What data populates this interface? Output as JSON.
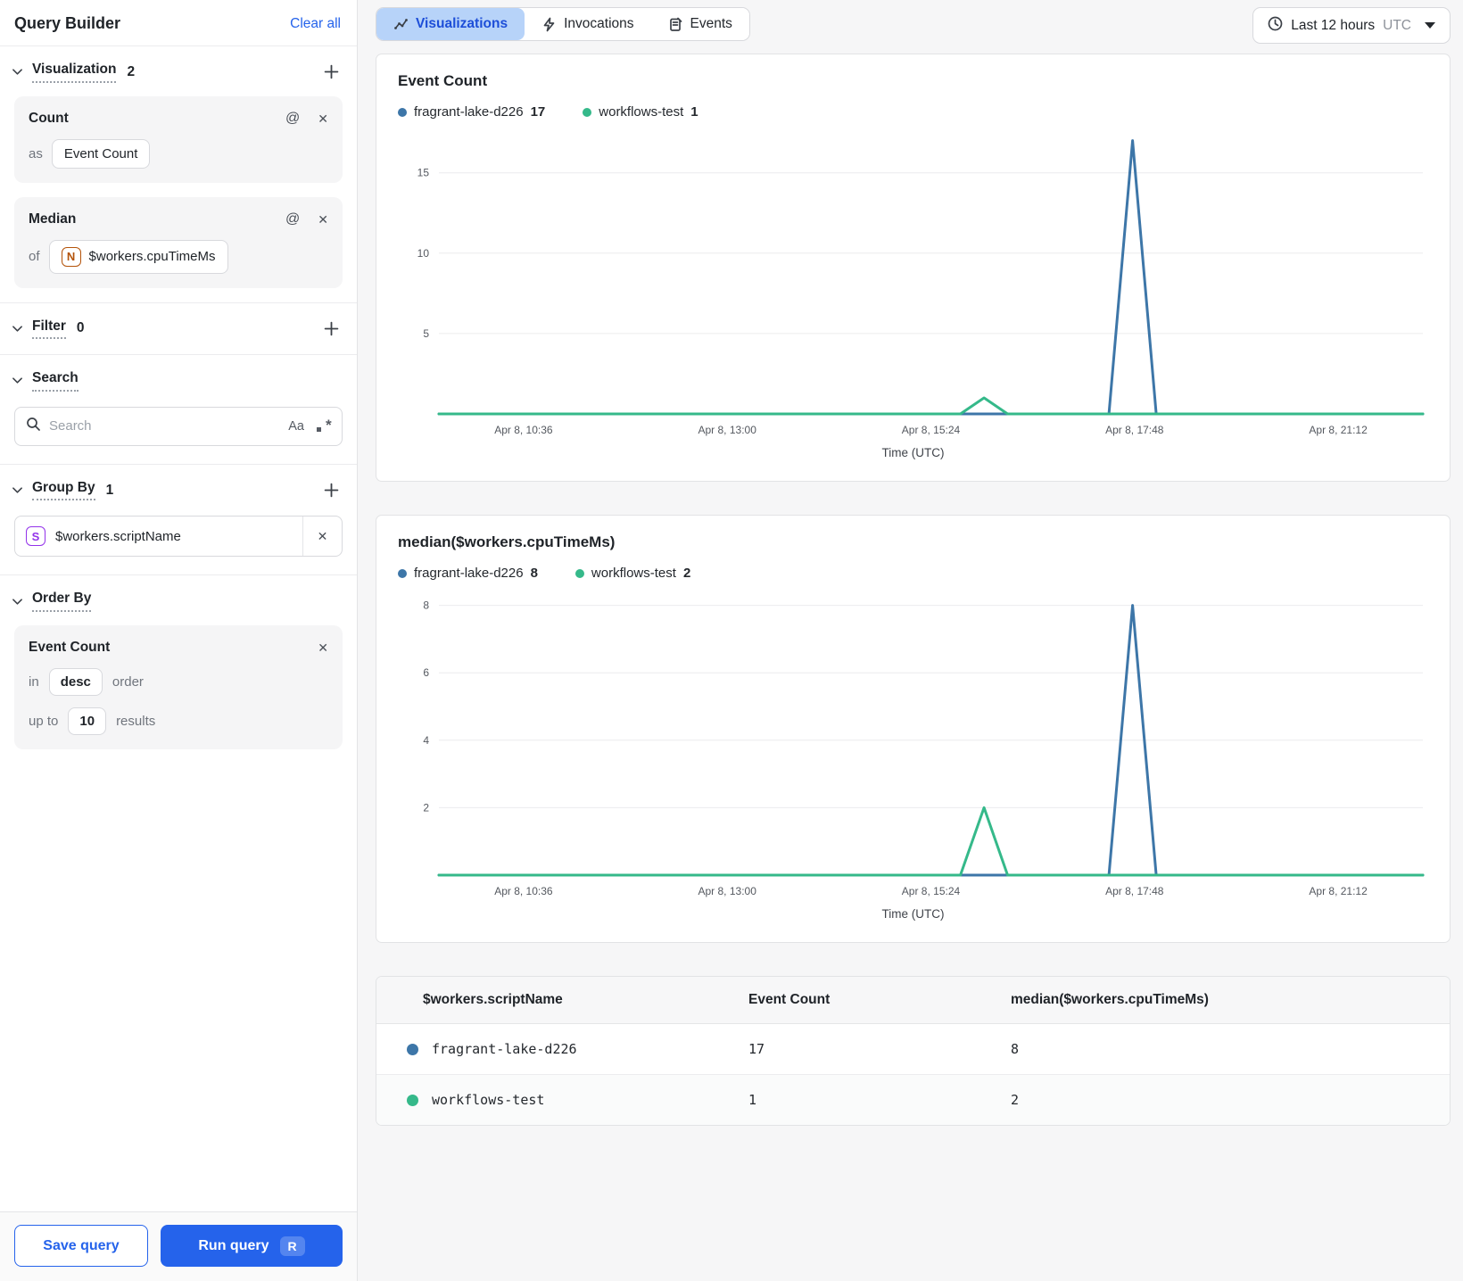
{
  "icons": {
    "at_sign": "@",
    "close": "✕",
    "regex_star": "*"
  },
  "sidebar": {
    "title": "Query Builder",
    "clear_all": "Clear all",
    "visualization": {
      "label": "Visualization",
      "count": "2",
      "cards": [
        {
          "name": "Count",
          "prefix": "as",
          "chip": "Event Count",
          "chip_icon": ""
        },
        {
          "name": "Median",
          "prefix": "of",
          "chip": "$workers.cpuTimeMs",
          "chip_icon": "N"
        }
      ]
    },
    "filter": {
      "label": "Filter",
      "count": "0"
    },
    "search": {
      "label": "Search",
      "placeholder": "Search",
      "case_icon": "Aa"
    },
    "group_by": {
      "label": "Group By",
      "count": "1",
      "item": {
        "icon": "S",
        "value": "$workers.scriptName"
      }
    },
    "order_by": {
      "label": "Order By",
      "field": "Event Count",
      "in_label": "in",
      "direction": "desc",
      "order_label": "order",
      "up_to_label": "up to",
      "limit": "10",
      "results_label": "results"
    },
    "save_button": "Save query",
    "run_button": "Run query",
    "run_shortcut": "R"
  },
  "toolbar": {
    "tabs": [
      {
        "label": "Visualizations",
        "active": true
      },
      {
        "label": "Invocations",
        "active": false
      },
      {
        "label": "Events",
        "active": false
      }
    ],
    "time_range": {
      "value": "Last 12 hours",
      "timezone": "UTC"
    }
  },
  "colors": {
    "series_blue": "#3d76a8",
    "series_green": "#35b98a",
    "accent_blue": "#2563eb",
    "active_tab_bg": "#b7d3f9",
    "grid": "#ececee"
  },
  "chart_data": [
    {
      "type": "line",
      "title": "Event Count",
      "xlabel": "Time (UTC)",
      "legend": [
        {
          "name": "fragrant-lake-d226",
          "value": 17,
          "color": "#3d76a8"
        },
        {
          "name": "workflows-test",
          "value": 1,
          "color": "#35b98a"
        }
      ],
      "x_ticks": [
        {
          "label": "Apr 8, 10:36",
          "pos": 0.086
        },
        {
          "label": "Apr 8, 13:00",
          "pos": 0.293
        },
        {
          "label": "Apr 8, 15:24",
          "pos": 0.5
        },
        {
          "label": "Apr 8, 17:48",
          "pos": 0.707
        },
        {
          "label": "Apr 8, 21:12",
          "pos": 0.914
        }
      ],
      "y_ticks": [
        5,
        10,
        15
      ],
      "ylim": [
        0,
        17.2
      ],
      "grid": true,
      "legend_position": "top",
      "series": [
        {
          "name": "fragrant-lake-d226",
          "color": "#3d76a8",
          "points": [
            [
              0,
              0
            ],
            [
              0.681,
              0
            ],
            [
              0.705,
              17
            ],
            [
              0.729,
              0
            ],
            [
              1,
              0
            ]
          ]
        },
        {
          "name": "workflows-test",
          "color": "#35b98a",
          "points": [
            [
              0,
              0
            ],
            [
              0.53,
              0
            ],
            [
              0.554,
              1
            ],
            [
              0.578,
              0
            ],
            [
              1,
              0
            ]
          ]
        }
      ]
    },
    {
      "type": "line",
      "title": "median($workers.cpuTimeMs)",
      "xlabel": "Time (UTC)",
      "legend": [
        {
          "name": "fragrant-lake-d226",
          "value": 8,
          "color": "#3d76a8"
        },
        {
          "name": "workflows-test",
          "value": 2,
          "color": "#35b98a"
        }
      ],
      "x_ticks": [
        {
          "label": "Apr 8, 10:36",
          "pos": 0.086
        },
        {
          "label": "Apr 8, 13:00",
          "pos": 0.293
        },
        {
          "label": "Apr 8, 15:24",
          "pos": 0.5
        },
        {
          "label": "Apr 8, 17:48",
          "pos": 0.707
        },
        {
          "label": "Apr 8, 21:12",
          "pos": 0.914
        }
      ],
      "y_ticks": [
        2,
        4,
        6,
        8
      ],
      "ylim": [
        0,
        8.2
      ],
      "grid": true,
      "legend_position": "top",
      "series": [
        {
          "name": "fragrant-lake-d226",
          "color": "#3d76a8",
          "points": [
            [
              0,
              0
            ],
            [
              0.681,
              0
            ],
            [
              0.705,
              8
            ],
            [
              0.729,
              0
            ],
            [
              1,
              0
            ]
          ]
        },
        {
          "name": "workflows-test",
          "color": "#35b98a",
          "points": [
            [
              0,
              0
            ],
            [
              0.53,
              0
            ],
            [
              0.554,
              2
            ],
            [
              0.578,
              0
            ],
            [
              1,
              0
            ]
          ]
        }
      ]
    }
  ],
  "table": {
    "columns": [
      "$workers.scriptName",
      "Event Count",
      "median($workers.cpuTimeMs)"
    ],
    "rows": [
      {
        "color": "#3d76a8",
        "script_name": "fragrant-lake-d226",
        "event_count": "17",
        "median": "8"
      },
      {
        "color": "#35b98a",
        "script_name": "workflows-test",
        "event_count": "1",
        "median": "2"
      }
    ]
  }
}
